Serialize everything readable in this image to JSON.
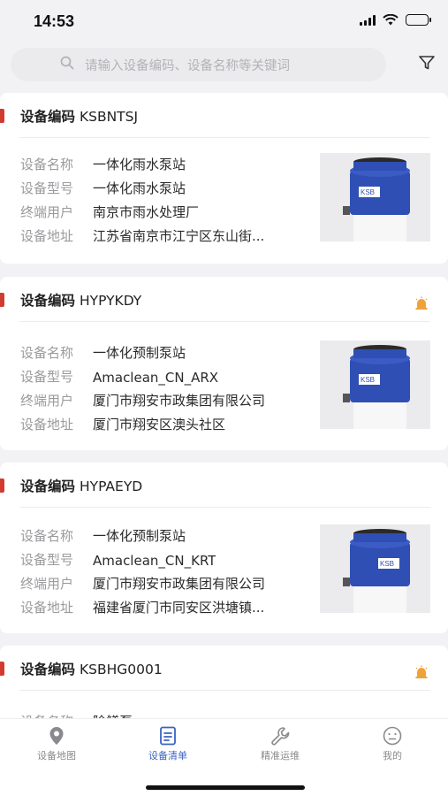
{
  "status_bar": {
    "time": "14:53"
  },
  "search": {
    "placeholder": "请输入设备编码、设备名称等关键词"
  },
  "field_labels": {
    "name": "设备名称",
    "model": "设备型号",
    "user": "终端用户",
    "address": "设备地址"
  },
  "code_label": "设备编码",
  "devices": [
    {
      "code": "KSBNTSJ",
      "name": "一体化雨水泵站",
      "model": "一体化雨水泵站",
      "user": "南京市雨水处理厂",
      "address": "江苏省南京市江宁区东山街...",
      "alarm": false
    },
    {
      "code": "HYPYKDY",
      "name": "一体化预制泵站",
      "model": "Amaclean_CN_ARX",
      "user": "厦门市翔安市政集团有限公司",
      "address": "厦门市翔安区澳头社区",
      "alarm": true
    },
    {
      "code": "HYPAEYD",
      "name": "一体化预制泵站",
      "model": "Amaclean_CN_KRT",
      "user": "厦门市翔安市政集团有限公司",
      "address": "福建省厦门市同安区洪塘镇...",
      "alarm": false
    },
    {
      "code": "KSBHG0001",
      "name": "除鳝泵",
      "model": "",
      "user": "",
      "address": "",
      "alarm": true
    }
  ],
  "tabs": [
    {
      "label": "设备地图",
      "icon": "location-pin-icon",
      "active": false
    },
    {
      "label": "设备清单",
      "icon": "list-document-icon",
      "active": true
    },
    {
      "label": "精准运维",
      "icon": "wrench-icon",
      "active": false
    },
    {
      "label": "我的",
      "icon": "user-face-icon",
      "active": false
    }
  ],
  "colors": {
    "accent": "#d23b30",
    "tab_active": "#3b63c4",
    "alarm": "#f0a23a",
    "pump_blue": "#2f4fb4"
  }
}
